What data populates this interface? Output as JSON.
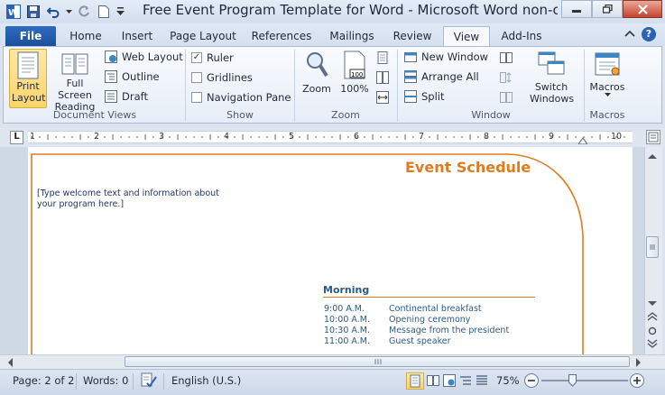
{
  "title_bar": {
    "title": "Free Event Program Template for Word  -  Microsoft Word non-com..."
  },
  "tabs": [
    {
      "label": "File"
    },
    {
      "label": "Home"
    },
    {
      "label": "Insert"
    },
    {
      "label": "Page Layout"
    },
    {
      "label": "References"
    },
    {
      "label": "Mailings"
    },
    {
      "label": "Review"
    },
    {
      "label": "View"
    },
    {
      "label": "Add-Ins"
    }
  ],
  "ribbon": {
    "document_views": {
      "label": "Document Views",
      "print_layout": "Print Layout",
      "full_screen_reading": "Full Screen Reading",
      "web_layout": "Web Layout",
      "outline": "Outline",
      "draft": "Draft"
    },
    "show": {
      "label": "Show",
      "ruler": "Ruler",
      "ruler_checked": true,
      "gridlines": "Gridlines",
      "navigation_pane": "Navigation Pane"
    },
    "zoom": {
      "label": "Zoom",
      "zoom": "Zoom",
      "hundred_percent": "100%"
    },
    "window": {
      "label": "Window",
      "new_window": "New Window",
      "arrange_all": "Arrange All",
      "split": "Split",
      "switch_windows": "Switch Windows"
    },
    "macros": {
      "label": "Macros",
      "macros": "Macros"
    }
  },
  "ruler": {
    "marks": [
      "1",
      "2",
      "3",
      "4",
      "5",
      "6",
      "7",
      "8",
      "9",
      "10"
    ]
  },
  "document": {
    "heading": "Event Schedule",
    "welcome_placeholder_line1": "[Type welcome text and information about",
    "welcome_placeholder_line2": "your program here.]",
    "section_title": "Morning",
    "schedule": [
      {
        "time": "9:00 A.M.",
        "event": "Continental breakfast"
      },
      {
        "time": "10:00 A.M.",
        "event": "Opening ceremony"
      },
      {
        "time": "10:30 A.M.",
        "event": "Message from the president"
      },
      {
        "time": "11:00 A.M.",
        "event": "Guest speaker"
      }
    ]
  },
  "status_bar": {
    "page": "Page: 2 of 2",
    "words": "Words: 0",
    "language": "English (U.S.)",
    "zoom_level": "75%"
  },
  "colors": {
    "accent_orange": "#e07b20",
    "heading_blue": "#2b5b86",
    "placeholder_blue": "#1f3864",
    "file_tab_blue": "#2a62b5"
  }
}
